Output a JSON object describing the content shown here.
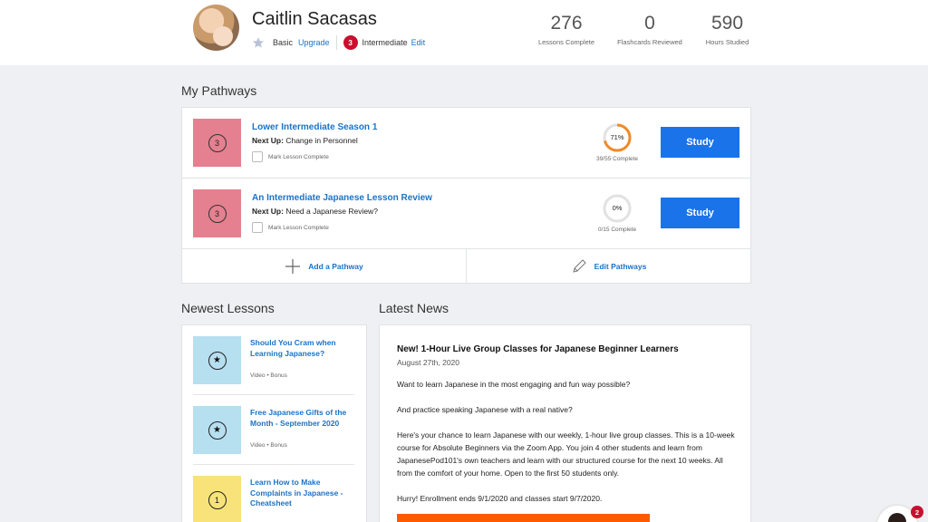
{
  "colors": {
    "accent": "#1a73c8",
    "study_button": "#1a73e8",
    "level_badge": "#c8102e",
    "pathway_thumb": "#e4808f",
    "progress_ring": "#f08a2a",
    "cta": "#ff5a00"
  },
  "profile": {
    "name": "Caitlin Sacasas",
    "plan_basic": "Basic",
    "upgrade": "Upgrade",
    "level_number": "3",
    "level_name": "Intermediate",
    "edit": "Edit"
  },
  "stats": [
    {
      "value": "276",
      "label": "Lessons Complete"
    },
    {
      "value": "0",
      "label": "Flashcards Reviewed"
    },
    {
      "value": "590",
      "label": "Hours Studied"
    }
  ],
  "pathways": {
    "title": "My Pathways",
    "items": [
      {
        "level": "3",
        "title": "Lower Intermediate Season 1",
        "next_label": "Next Up:",
        "next_value": "Change in Personnel",
        "mark_label": "Mark Lesson Complete",
        "percent_text": "71%",
        "progress": 0.71,
        "complete_text": "39/55 Complete",
        "study": "Study"
      },
      {
        "level": "3",
        "title": "An Intermediate Japanese Lesson Review",
        "next_label": "Next Up:",
        "next_value": "Need a Japanese Review?",
        "mark_label": "Mark Lesson Complete",
        "percent_text": "0%",
        "progress": 0,
        "complete_text": "0/15 Complete",
        "study": "Study"
      }
    ],
    "add": "Add a Pathway",
    "edit": "Edit Pathways"
  },
  "newest_lessons": {
    "title": "Newest Lessons",
    "items": [
      {
        "title": "Should You Cram when Learning Japanese?",
        "meta": "Video • Bonus",
        "icon": "star-icon",
        "thumb_color": "#b6dff0"
      },
      {
        "title": "Free Japanese Gifts of the Month - September 2020",
        "meta": "Video • Bonus",
        "icon": "star-icon",
        "thumb_color": "#b6dff0"
      },
      {
        "title": "Learn How to Make Complaints in Japanese - Cheatsheet",
        "meta": "",
        "icon": "level-1-icon",
        "icon_text": "1",
        "thumb_color": "#f8e37a"
      }
    ]
  },
  "news": {
    "title": "Latest News",
    "headline": "New! 1-Hour Live Group Classes for Japanese Beginner Learners",
    "date": "August 27th, 2020",
    "paragraphs": [
      "Want to learn Japanese in the most engaging and fun way possible?",
      "And practice speaking Japanese with a real native?",
      "Here's your chance to learn Japanese with our weekly, 1-hour live group classes. This is a 10-week course for Absolute Beginners via the Zoom App. You join 4 other students and learn from JapanesePod101's own teachers and learn with our structured course for the next 10 weeks. All from the comfort of your home. Open to the first 50 students only.",
      "Hurry! Enrollment ends 9/1/2020 and classes start 9/7/2020."
    ]
  },
  "chat": {
    "badge": "2"
  }
}
